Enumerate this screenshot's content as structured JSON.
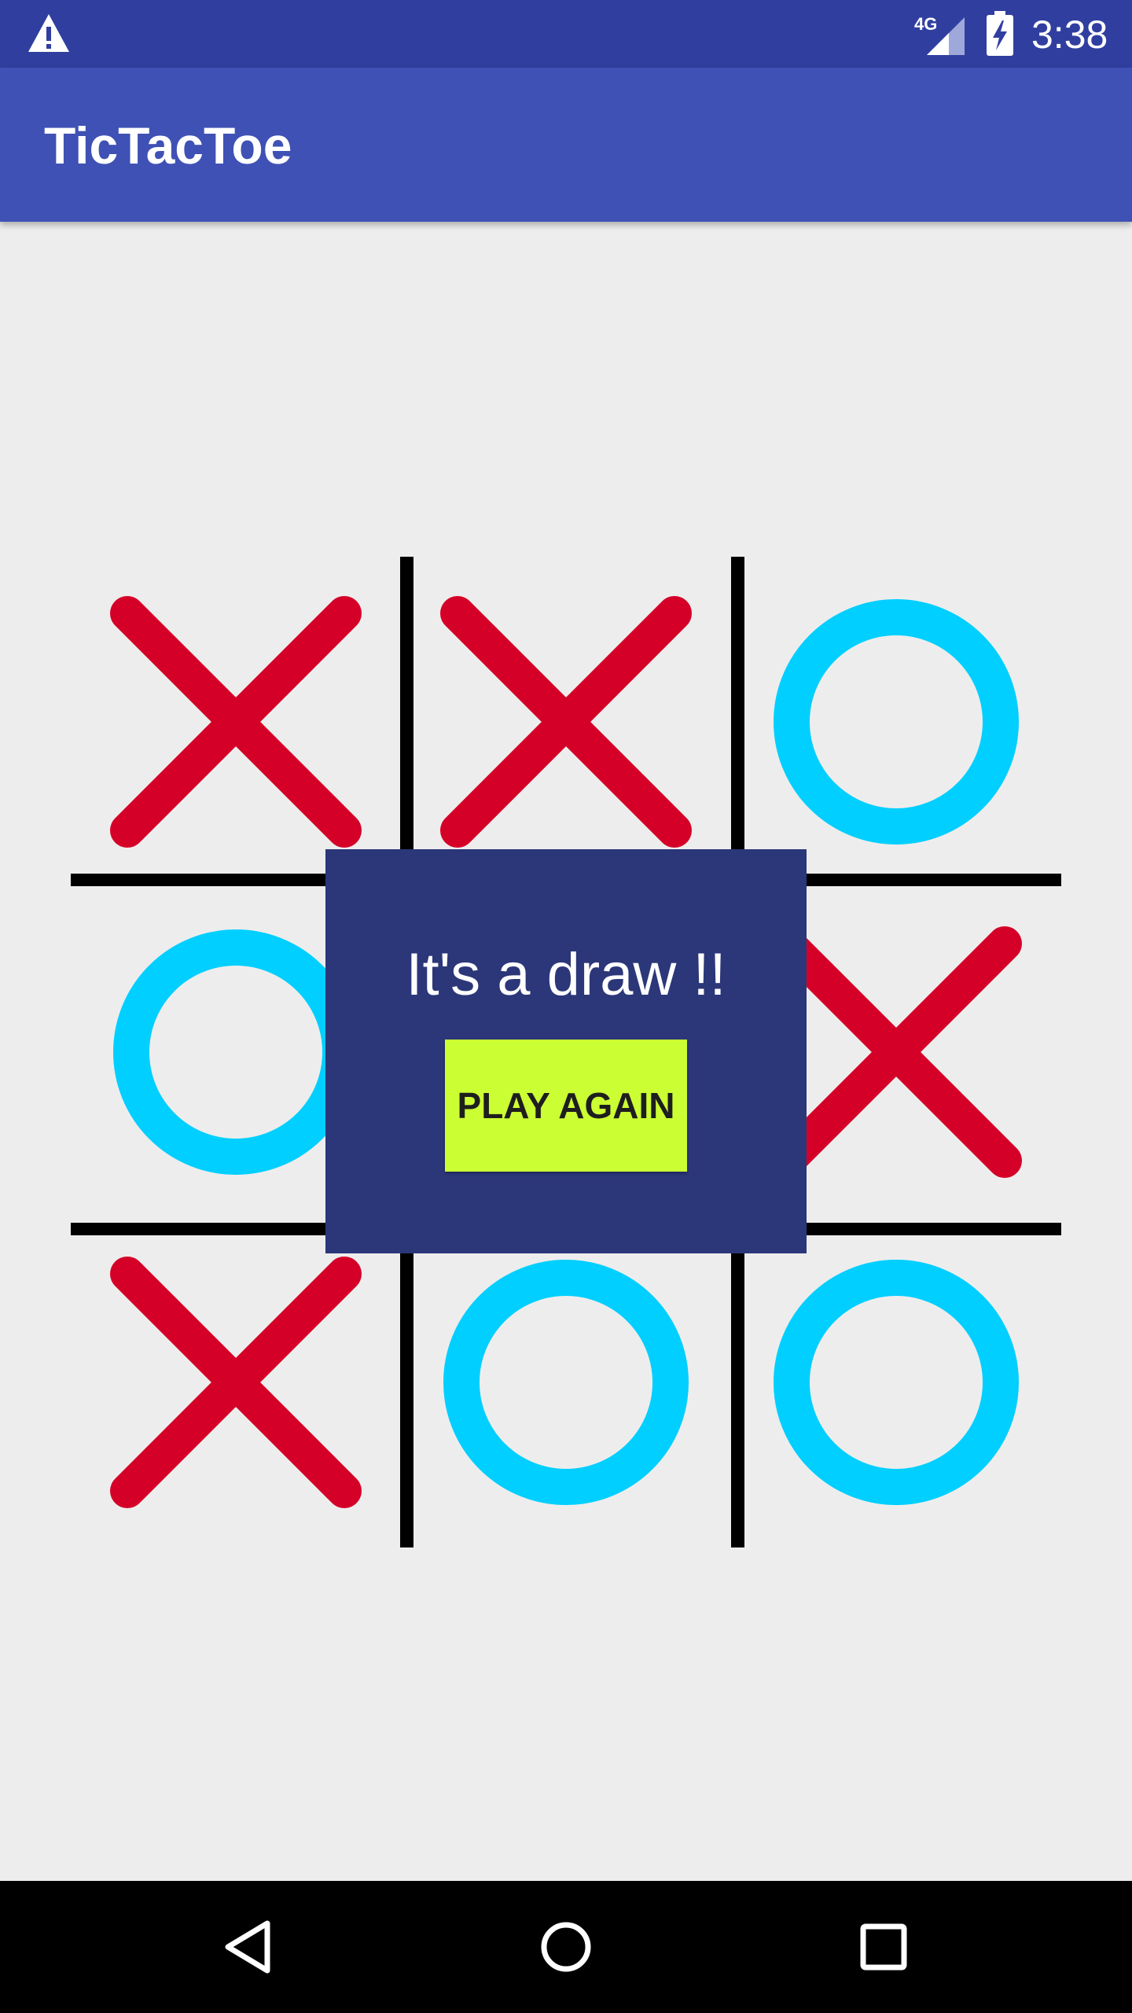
{
  "status_bar": {
    "time": "3:38",
    "network_label": "4G",
    "icons": [
      "warning-icon",
      "signal-4g-icon",
      "battery-charging-icon"
    ]
  },
  "app_bar": {
    "title": "TicTacToe"
  },
  "board": {
    "cells": [
      "X",
      "X",
      "O",
      "O",
      "",
      "X",
      "X",
      "O",
      "O"
    ],
    "colors": {
      "x": "#D50027",
      "o": "#00CFFF",
      "grid": "#000000"
    }
  },
  "dialog": {
    "message": "It's a draw !!",
    "button_label": "PLAY AGAIN",
    "background": "#2C3779",
    "button_color": "#CCFF33"
  },
  "nav_bar": {
    "icons": [
      "back-icon",
      "home-icon",
      "recents-icon"
    ]
  },
  "colors": {
    "status_bar": "#303F9F",
    "app_bar": "#3F51B5",
    "background": "#EEEDED"
  }
}
